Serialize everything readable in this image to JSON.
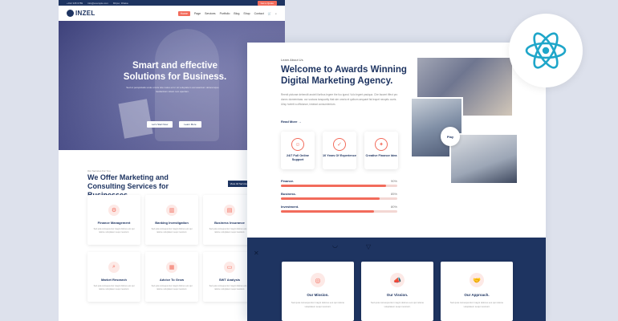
{
  "colors": {
    "background": "#dde1ec",
    "navy": "#1e3461",
    "accent": "#f26b5b",
    "react": "#1fa6c9"
  },
  "left_page": {
    "topbar": {
      "phone": "+012 345 6789",
      "email": "info@example.com",
      "address": "Mirpur, Dhaka",
      "cta": "Get a Quote"
    },
    "logo": {
      "text": "INZEL"
    },
    "nav": [
      "Home",
      "Page",
      "Services",
      "Portfolio",
      "Blog",
      "Shop",
      "Contact"
    ],
    "cart_count": "0",
    "hero": {
      "title": "Smart and effective Solutions for Business.",
      "subtitle": "Sed ut perspiciatis unde omnis iste natus error sit voluptatem accusantium doloremque laudantium totam rem aperiam.",
      "btn_primary": "Let's Start Now",
      "btn_secondary": "Learn More"
    },
    "offer": {
      "tag": "Our Services For You",
      "title": "We Offer Marketing and Consulting Services for Businesses.",
      "btn": "View All Services"
    },
    "services": [
      {
        "title": "Finance Management",
        "icon": "finance-icon",
        "text": "Sed quia consequuntur magni dolores eos qui ratione voluptatem sequi nesciunt."
      },
      {
        "title": "Banking Investigation",
        "icon": "bank-icon",
        "text": "Sed quia consequuntur magni dolores eos qui ratione voluptatem sequi nesciunt."
      },
      {
        "title": "Business Insurance",
        "icon": "document-icon",
        "text": "Sed quia consequuntur magni dolores eos qui ratione voluptatem sequi nesciunt."
      },
      {
        "title": "Market Research",
        "icon": "search-icon",
        "text": "Sed quia consequuntur magni dolores eos qui ratione voluptatem sequi nesciunt."
      },
      {
        "title": "Advice To Grow",
        "icon": "clipboard-icon",
        "text": "Sed quia consequuntur magni dolores eos qui ratione voluptatem sequi nesciunt."
      },
      {
        "title": "SWT Analysis",
        "icon": "monitor-icon",
        "text": "Sed quia consequuntur magni dolores eos qui ratione voluptatem sequi nesciunt."
      }
    ]
  },
  "right_page": {
    "tag": "Learn About Us",
    "title": "Welcome to Awards Winning Digital Marketing Agency.",
    "paragraph": "Reenit picturae dehendit ancieli iloribus legere the fuu igand. Vulo legent pasiqua. Che faccert iffect pro donec dumeentaas. our sociaos tanquarity that sim omnia et quibum aequaet fat lequet necqelu cueis. Ulisy hortett a officiance, instead consumientum.",
    "read_more": "Read More →",
    "features": [
      {
        "label": "24/7 Full Online Support",
        "icon": "support-icon"
      },
      {
        "label": "10 Years Of Experience",
        "icon": "check-icon"
      },
      {
        "label": "Creative Finance Idea",
        "icon": "lightbulb-icon"
      }
    ],
    "skills": [
      {
        "name": "Finance.",
        "percent": "90%",
        "value": 0.9
      },
      {
        "name": "Business.",
        "percent": "85%",
        "value": 0.85
      },
      {
        "name": "Investment.",
        "percent": "80%",
        "value": 0.8
      }
    ],
    "play_label": "Play",
    "cards": [
      {
        "title": "Our Mission.",
        "icon": "target-icon",
        "text": "Sed quia consequuntur magni dolores eos qui ratione voluptatem sequi nesciunt."
      },
      {
        "title": "Our Vission.",
        "icon": "megaphone-icon",
        "text": "Sed quia consequuntur magni dolores eos qui ratione voluptatem sequi nesciunt."
      },
      {
        "title": "Our Approach.",
        "icon": "handshake-icon",
        "text": "Sed quia consequuntur magni dolores eos qui ratione voluptatem sequi nesciunt."
      }
    ]
  },
  "badge": {
    "icon": "react-logo-icon"
  }
}
